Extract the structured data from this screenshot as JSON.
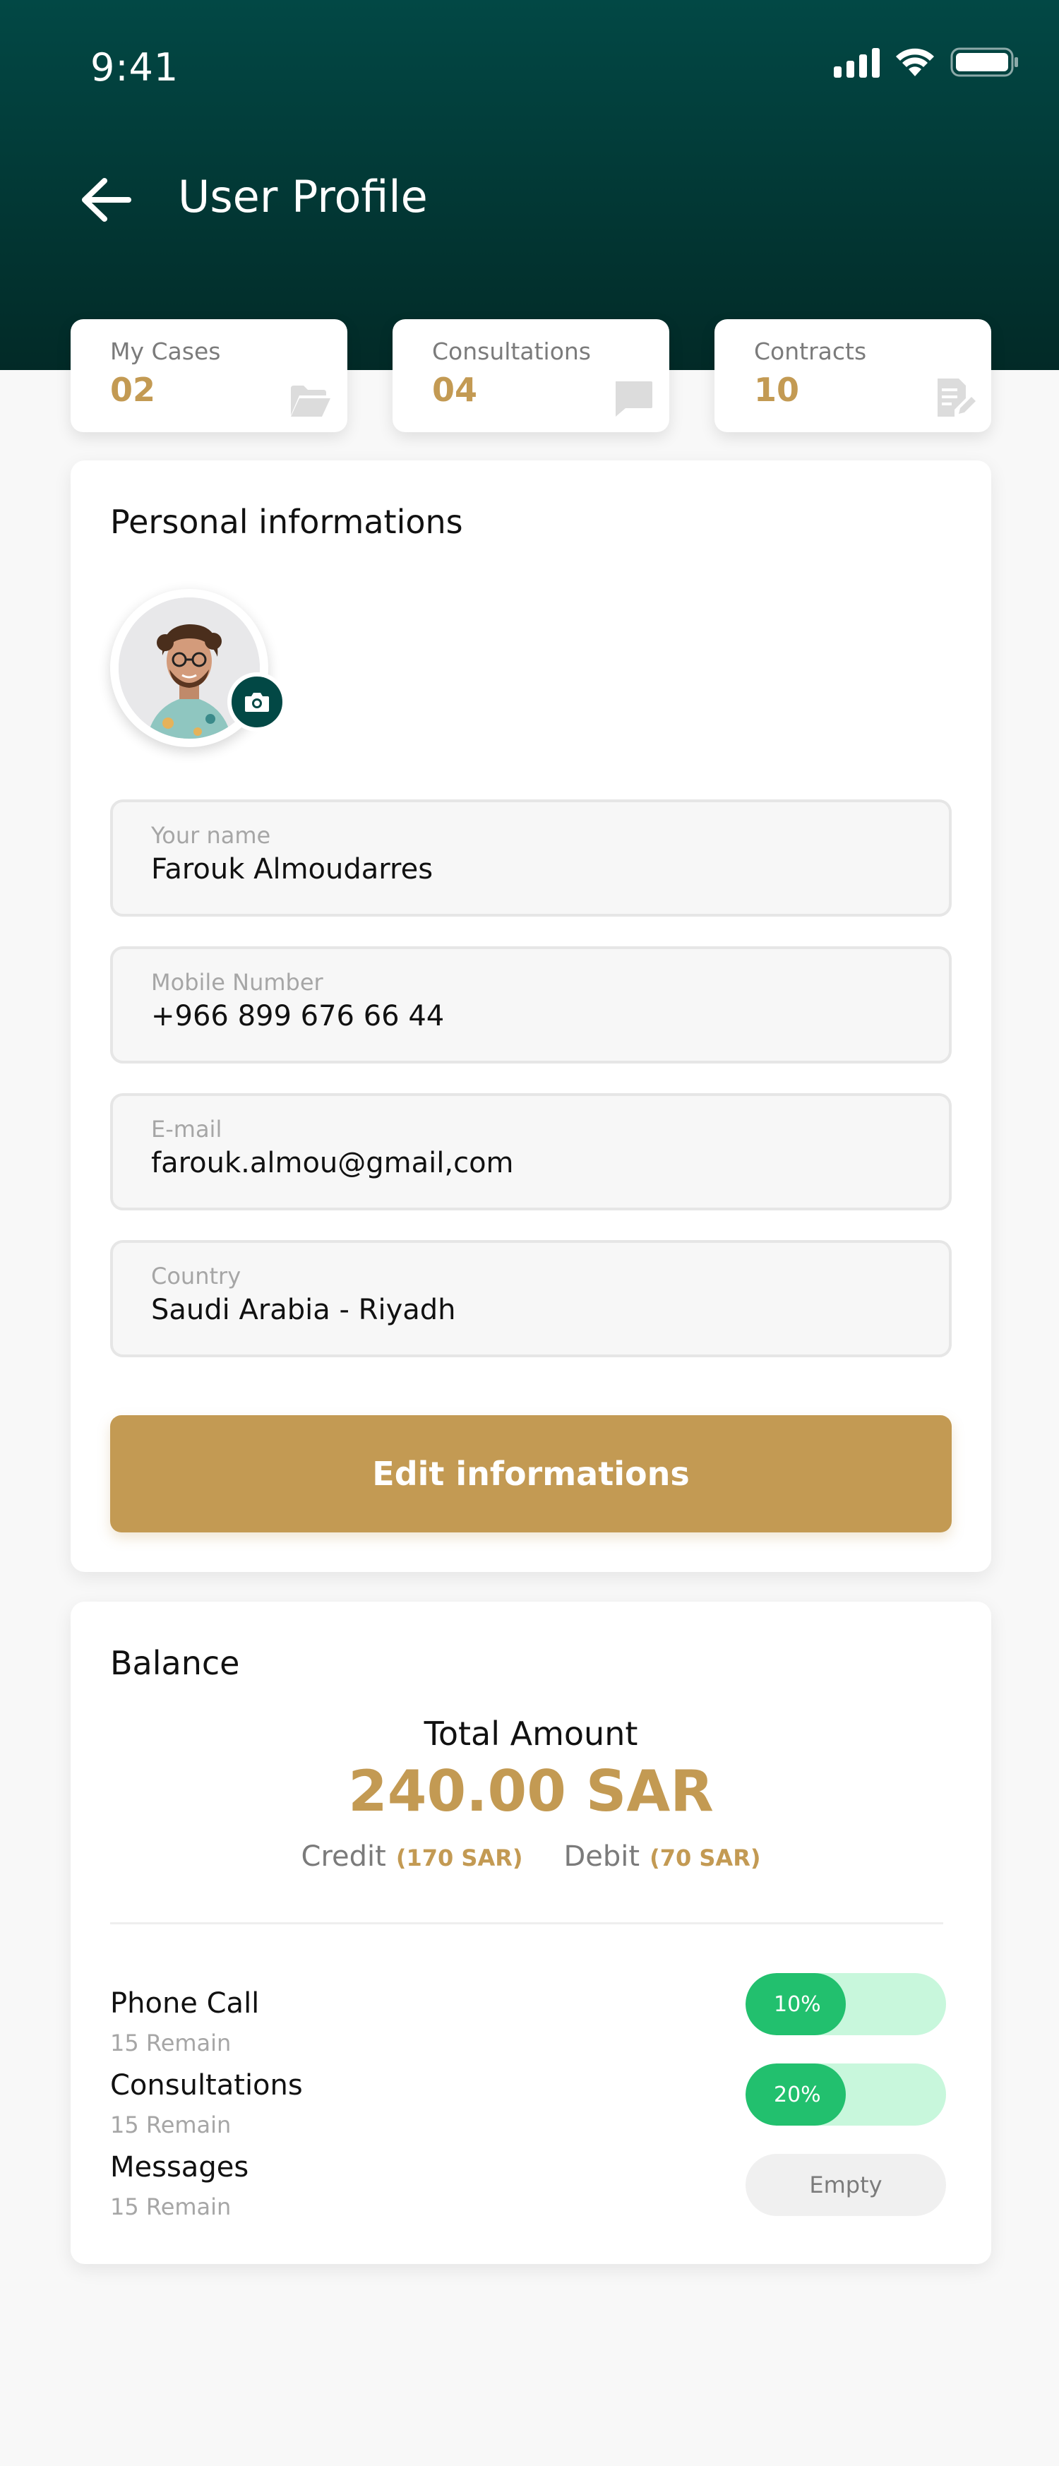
{
  "status_bar": {
    "time": "9:41"
  },
  "header": {
    "title": "User Profile"
  },
  "stats": [
    {
      "label": "My Cases",
      "value": "02",
      "icon": "folder-icon"
    },
    {
      "label": "Consultations",
      "value": "04",
      "icon": "chat-icon"
    },
    {
      "label": "Contracts",
      "value": "10",
      "icon": "document-edit-icon"
    }
  ],
  "personal": {
    "title": "Personal informations",
    "fields": [
      {
        "label": "Your name",
        "value": "Farouk Almoudarres"
      },
      {
        "label": "Mobile Number",
        "value": "+966 899 676 66 44"
      },
      {
        "label": "E-mail",
        "value": "farouk.almou@gmail,com"
      },
      {
        "label": "Country",
        "value": "Saudi Arabia - Riyadh"
      }
    ],
    "edit_button": "Edit informations"
  },
  "balance": {
    "title": "Balance",
    "total_label": "Total Amount",
    "total_amount": "240.00 SAR",
    "credit_label": "Credit",
    "credit_amount": "(170 SAR)",
    "debit_label": "Debit",
    "debit_amount": "(70 SAR)",
    "usage": [
      {
        "title": "Phone Call",
        "remain": "15 Remain",
        "progress": 0.1,
        "progress_label": "10%"
      },
      {
        "title": "Consultations",
        "remain": "15 Remain",
        "progress": 0.2,
        "progress_label": "20%"
      },
      {
        "title": "Messages",
        "remain": "15 Remain",
        "progress": 0,
        "progress_label": "Empty"
      }
    ]
  },
  "colors": {
    "header": "#024845",
    "accent_gold": "#c39a53",
    "progress_green": "#22c06e",
    "progress_track": "#c8f7dc"
  }
}
